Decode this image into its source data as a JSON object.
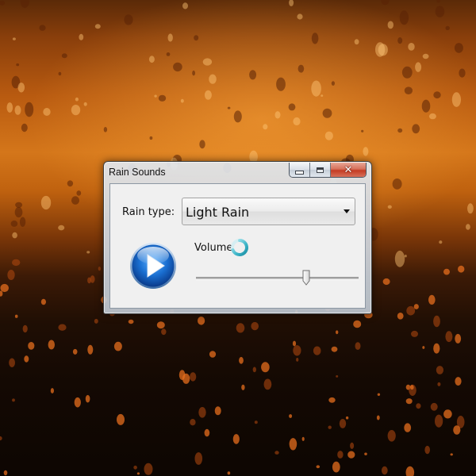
{
  "window": {
    "title": "Rain Sounds",
    "close_symbol": "✕"
  },
  "form": {
    "rain_type_label": "Rain type:",
    "rain_type_value": "Light Rain",
    "volume_label": "Volume",
    "volume_level": 0.68
  },
  "icons": {
    "play": "play-icon",
    "busy": "loading-spinner-icon",
    "minimize": "minimize-icon",
    "maximize": "maximize-icon",
    "close": "close-icon",
    "dropdown": "chevron-down-icon"
  },
  "colors": {
    "play_blue": "#1a6fd1",
    "spinner_teal": "#3fb6c9",
    "close_red": "#c43c23"
  }
}
